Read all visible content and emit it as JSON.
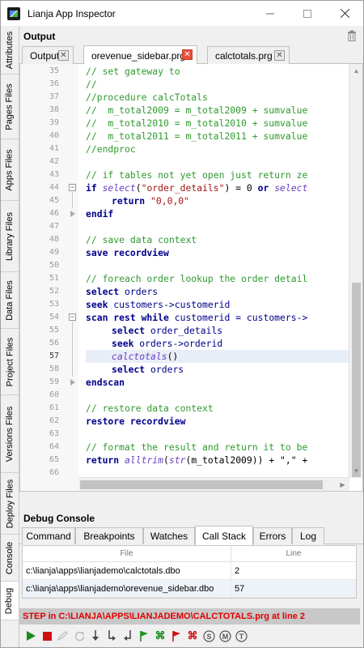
{
  "window": {
    "title": "Lianja App Inspector"
  },
  "vertical_tabs": [
    {
      "label": "Attributes"
    },
    {
      "label": "Pages Files"
    },
    {
      "label": "Apps Files"
    },
    {
      "label": "Library Files"
    },
    {
      "label": "Data Files"
    },
    {
      "label": "Project Files"
    },
    {
      "label": "Versions Files"
    },
    {
      "label": "Deploy Files"
    },
    {
      "label": "Console"
    },
    {
      "label": "Debug"
    }
  ],
  "output_panel": {
    "title": "Output",
    "tabs": [
      {
        "label": "Output"
      },
      {
        "label": "orevenue_sidebar.prg"
      },
      {
        "label": "calctotals.prg"
      }
    ]
  },
  "editor": {
    "lines": [
      {
        "num": "35",
        "text": "// set gateway to"
      },
      {
        "num": "36",
        "text": "//"
      },
      {
        "num": "37",
        "text": "//procedure calcTotals"
      },
      {
        "num": "38",
        "text": "//  m_total2009 = m_total2009 + sumvalue"
      },
      {
        "num": "39",
        "text": "//  m_total2010 = m_total2010 + sumvalue"
      },
      {
        "num": "40",
        "text": "//  m_total2011 = m_total2011 + sumvalue"
      },
      {
        "num": "41",
        "text": "//endproc"
      },
      {
        "num": "42",
        "text": ""
      },
      {
        "num": "43",
        "text": "// if tables not yet open just return ze"
      },
      {
        "num": "44",
        "k1": "if ",
        "f1": "select",
        "p1": "(",
        "s1": "\"order_details\"",
        "p2": ") = 0 ",
        "k2": "or ",
        "f2": "select"
      },
      {
        "num": "45",
        "k1": "return ",
        "s1": "\"0,0,0\""
      },
      {
        "num": "46",
        "k1": "endif"
      },
      {
        "num": "47",
        "text": ""
      },
      {
        "num": "48",
        "text": "// save data context"
      },
      {
        "num": "49",
        "k1": "save recordview"
      },
      {
        "num": "50",
        "text": ""
      },
      {
        "num": "51",
        "text": "// foreach order lookup the order detail"
      },
      {
        "num": "52",
        "k1": "select ",
        "p1": "orders"
      },
      {
        "num": "53",
        "k1": "seek ",
        "p1": "customers->customerid"
      },
      {
        "num": "54",
        "k1": "scan rest while ",
        "p1": "customerid = customers->"
      },
      {
        "num": "55",
        "k1": "select ",
        "p1": "order_details"
      },
      {
        "num": "56",
        "k1": "seek ",
        "p1": "orders->orderid"
      },
      {
        "num": "57",
        "f1": "calctotals",
        "p1": "()"
      },
      {
        "num": "58",
        "k1": "select ",
        "p1": "orders"
      },
      {
        "num": "59",
        "k1": "endscan"
      },
      {
        "num": "60",
        "text": ""
      },
      {
        "num": "61",
        "text": "// restore data context"
      },
      {
        "num": "62",
        "k1": "restore recordview"
      },
      {
        "num": "63",
        "text": ""
      },
      {
        "num": "64",
        "text": "// format the result and return it to be"
      },
      {
        "num": "65",
        "k1": "return ",
        "f1": "alltrim",
        "p1": "(",
        "f2": "str",
        "p2": "(m_total2009)) + \",\" +"
      },
      {
        "num": "66",
        "text": ""
      }
    ]
  },
  "debug_console": {
    "title": "Debug Console",
    "tabs": [
      {
        "label": "Command"
      },
      {
        "label": "Breakpoints"
      },
      {
        "label": "Watches"
      },
      {
        "label": "Call Stack"
      },
      {
        "label": "Errors"
      },
      {
        "label": "Log"
      }
    ],
    "call_stack": {
      "headers": {
        "file": "File",
        "line": "Line"
      },
      "rows": [
        {
          "file": "c:\\lianja\\apps\\lianjademo\\calctotals.dbo",
          "line": "2"
        },
        {
          "file": "c:\\lianja\\apps\\lianjademo\\orevenue_sidebar.dbo",
          "line": "57"
        }
      ]
    },
    "status": "STEP in C:\\LIANJA\\APPS\\LIANJADEMO\\CALCTOTALS.prg at line 2"
  },
  "toolbar": {
    "icons": [
      "run-icon",
      "stop-icon",
      "edit-disabled-icon",
      "restart-icon",
      "step-over-icon",
      "step-into-icon",
      "step-out-icon",
      "green-flag-icon",
      "green-shuffle-icon",
      "red-flag-icon",
      "red-shuffle-icon",
      "s-circle-icon",
      "m-circle-icon",
      "t-circle-icon"
    ]
  },
  "colors": {
    "comment": "#2e9a2e",
    "keyword": "#00008b",
    "string": "#a31515",
    "function": "#6a3fbf",
    "status_text": "#e00000"
  }
}
